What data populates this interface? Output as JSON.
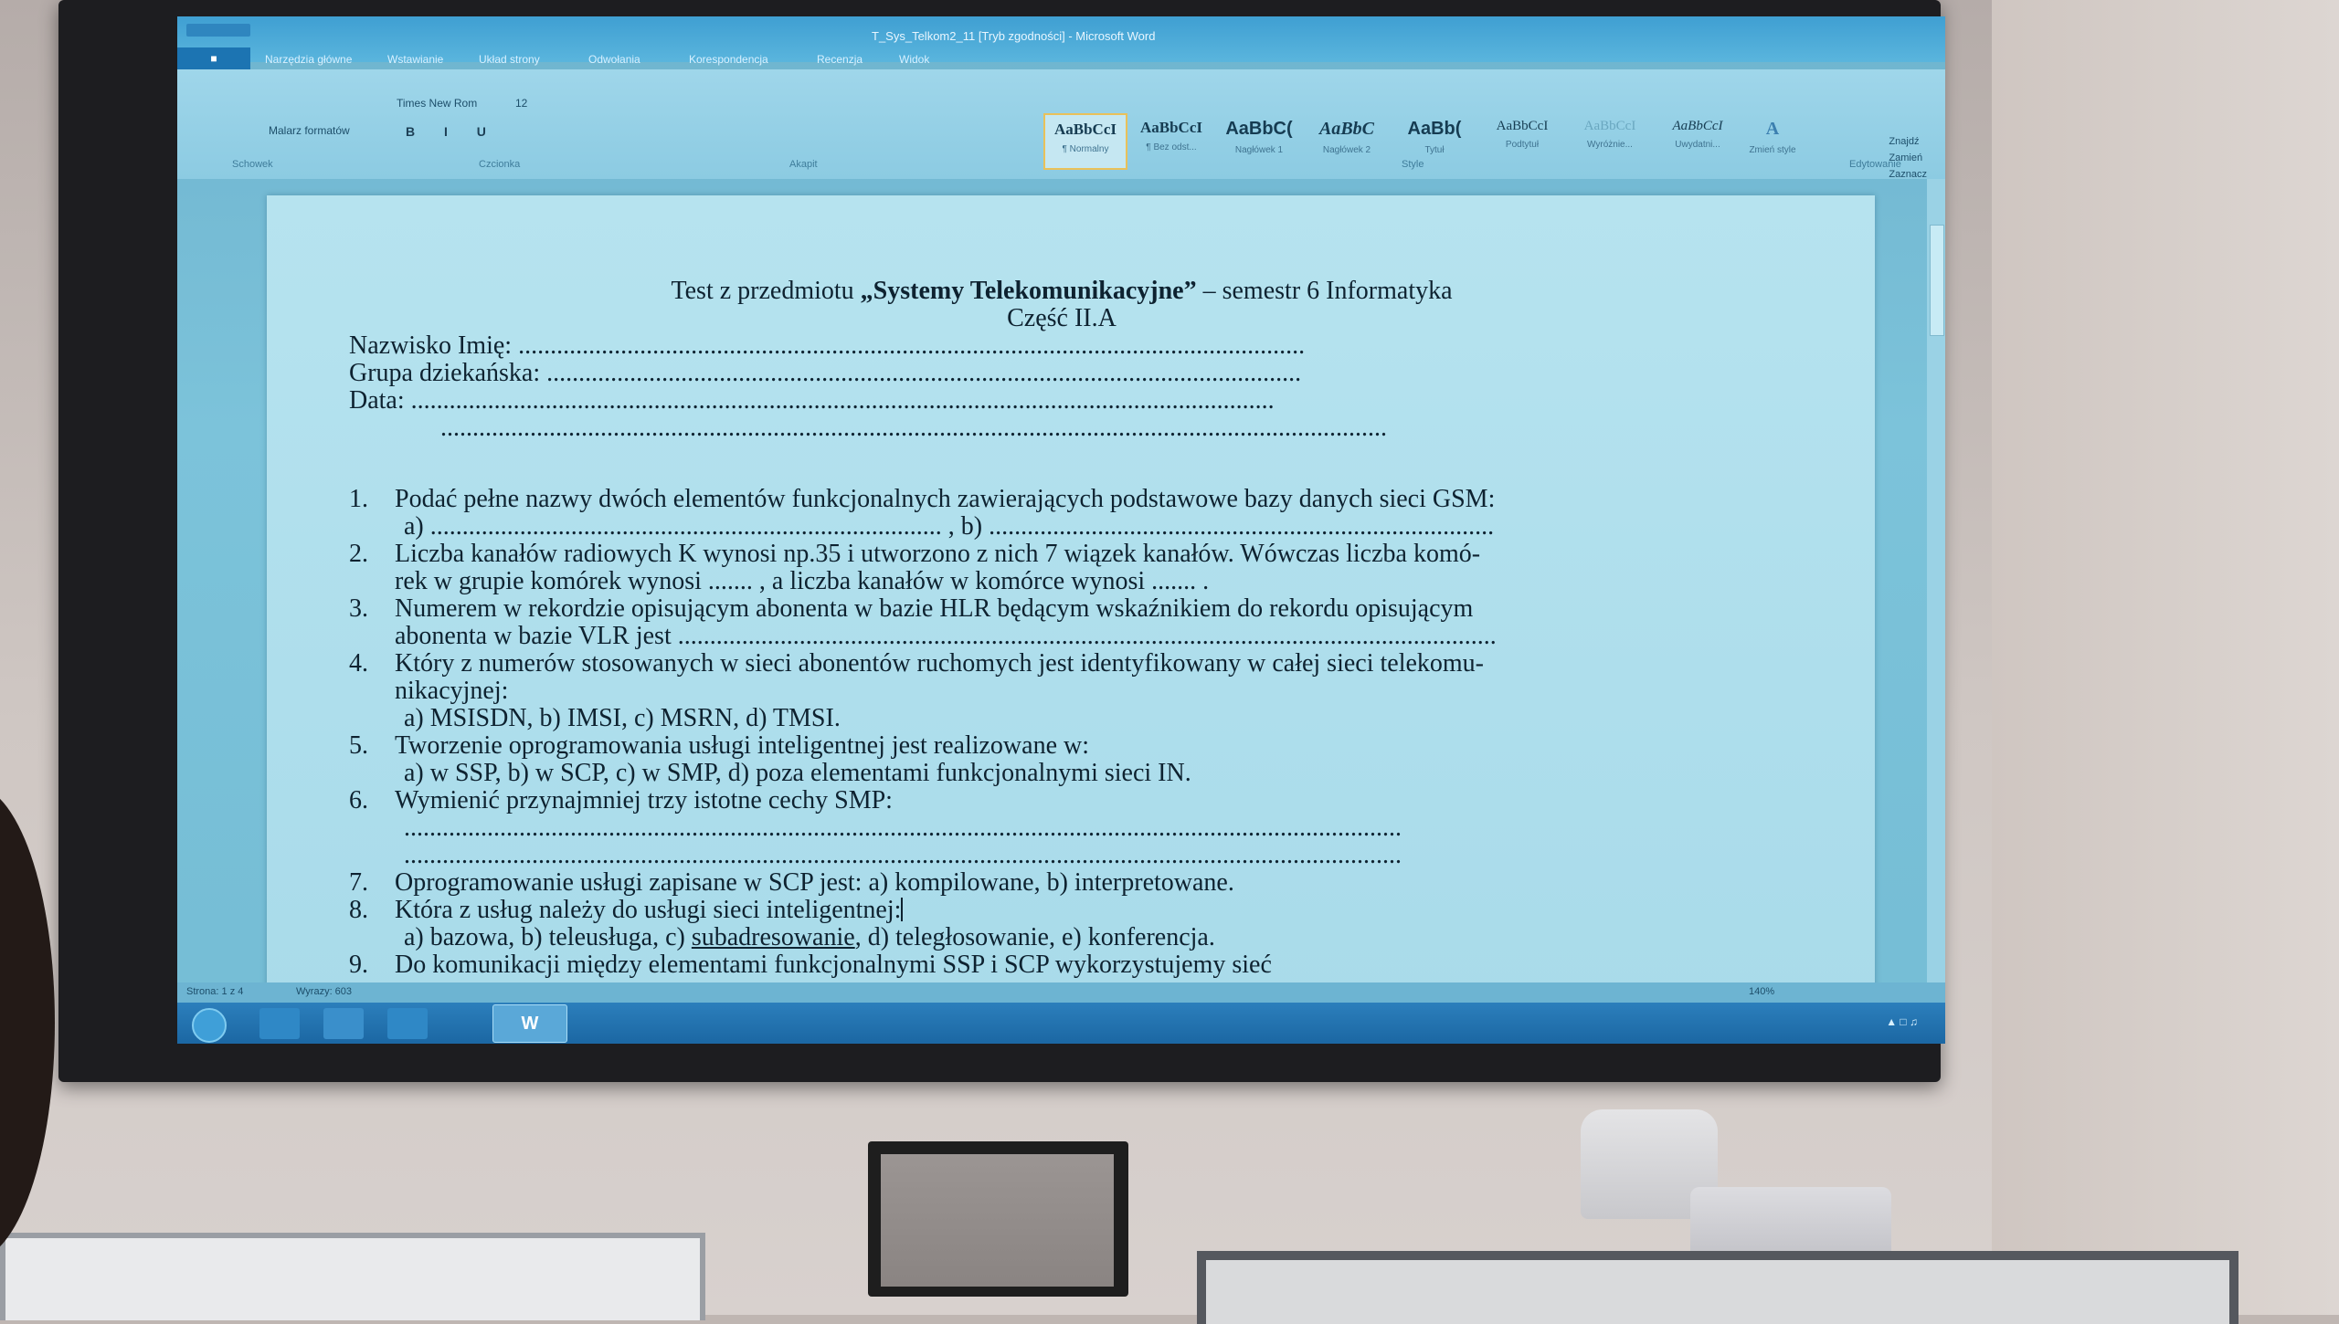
{
  "window": {
    "title": "T_Sys_Telkom2_11 [Tryb zgodności] - Microsoft Word"
  },
  "tabs": [
    "Narzędzia główne",
    "Wstawianie",
    "Układ strony",
    "Odwołania",
    "Korespondencja",
    "Recenzja",
    "Widok"
  ],
  "ribbon": {
    "font_name": "Times New Rom",
    "font_size": "12",
    "format_painter": "Malarz formatów",
    "styles": [
      {
        "sample": "AaBbCcI",
        "name": "¶ Normalny"
      },
      {
        "sample": "AaBbCcI",
        "name": "¶ Bez odst..."
      },
      {
        "sample": "AaBbC(",
        "name": "Nagłówek 1"
      },
      {
        "sample": "AaBbC",
        "name": "Nagłówek 2"
      },
      {
        "sample": "AaBb(",
        "name": "Tytuł"
      },
      {
        "sample": "AaBbCcI",
        "name": "Podtytuł"
      },
      {
        "sample": "AaBbCcI",
        "name": "Wyróżnie..."
      },
      {
        "sample": "AaBbCcI",
        "name": "Uwydatni..."
      }
    ],
    "groups": {
      "clipboard": "Schowek",
      "font": "Czcionka",
      "paragraph": "Akapit",
      "styles": "Style",
      "editing": "Edytowanie"
    },
    "change_styles": "Zmień style",
    "edit_find": "Znajdź",
    "edit_replace": "Zamień",
    "edit_select": "Zaznacz"
  },
  "document": {
    "title_prefix": "Test z przedmiotu ",
    "title_subject": "„Systemy Telekomunikacyjne”",
    "title_suffix": " – semestr 6 Informatyka",
    "subtitle": "Część II.A",
    "fields": [
      {
        "label": "Nazwisko Imię:",
        "dots": "..........................................................................................................................."
      },
      {
        "label": "Grupa dziekańska:",
        "dots": "......................................................................................................................"
      },
      {
        "label": "Data:",
        "dots": "......................................................................................................................................."
      }
    ],
    "extra_dots": "....................................................................................................................................................",
    "questions": [
      {
        "num": "1.",
        "text": "Podać pełne nazwy dwóch elementów funkcjonalnych zawierających podstawowe bazy danych sieci GSM:",
        "sub": "a) ................................................................................ , b) ..............................................................................."
      },
      {
        "num": "2.",
        "text": "Liczba kanałów radiowych K wynosi np.35 i utworzono z nich 7 wiązek kanałów. Wówczas liczba komó-",
        "sub": "rek w grupie komórek wynosi ....... , a liczba kanałów w komórce wynosi ....... ."
      },
      {
        "num": "3.",
        "text": "Numerem w rekordzie opisującym abonenta w bazie HLR będącym wskaźnikiem do rekordu opisującym",
        "sub": "abonenta w bazie VLR jest ................................................................................................................................"
      },
      {
        "num": "4.",
        "text": "Który z numerów stosowanych w sieci abonentów ruchomych jest identyfikowany w całej sieci telekomu-",
        "sub": "nikacyjnej:",
        "sub2": "a) MSISDN, b) IMSI, c) MSRN, d) TMSI."
      },
      {
        "num": "5.",
        "text": "Tworzenie oprogramowania usługi inteligentnej jest realizowane w:",
        "sub": "a) w SSP, b) w SCP, c) w SMP, d) poza elementami funkcjonalnymi sieci IN."
      },
      {
        "num": "6.",
        "text": "Wymienić przynajmniej trzy istotne cechy SMP:",
        "sub": "............................................................................................................................................................",
        "sub2": "............................................................................................................................................................"
      },
      {
        "num": "7.",
        "text": "Oprogramowanie usługi zapisane w SCP jest: a) kompilowane, b) interpretowane."
      },
      {
        "num": "8.",
        "text": "Która z usług należy do usługi sieci inteligentnej:",
        "sub_a": "a) bazowa, b) teleusługa, c) ",
        "sub_u": "subadresowanie",
        "sub_b": ", d) teległosowanie, e) konferencja."
      },
      {
        "num": "9.",
        "text": "Do komunikacji między elementami funkcjonalnymi SSP i SCP wykorzystujemy sieć"
      }
    ]
  },
  "statusbar": {
    "page": "Strona: 1 z 4",
    "words": "Wyrazy: 603",
    "zoom": "140%"
  },
  "taskbar": {
    "word_icon": "W"
  },
  "colors": {
    "screen": "#7cc3da",
    "taskbar": "#1b67a3",
    "wall": "#cfc7c3"
  }
}
